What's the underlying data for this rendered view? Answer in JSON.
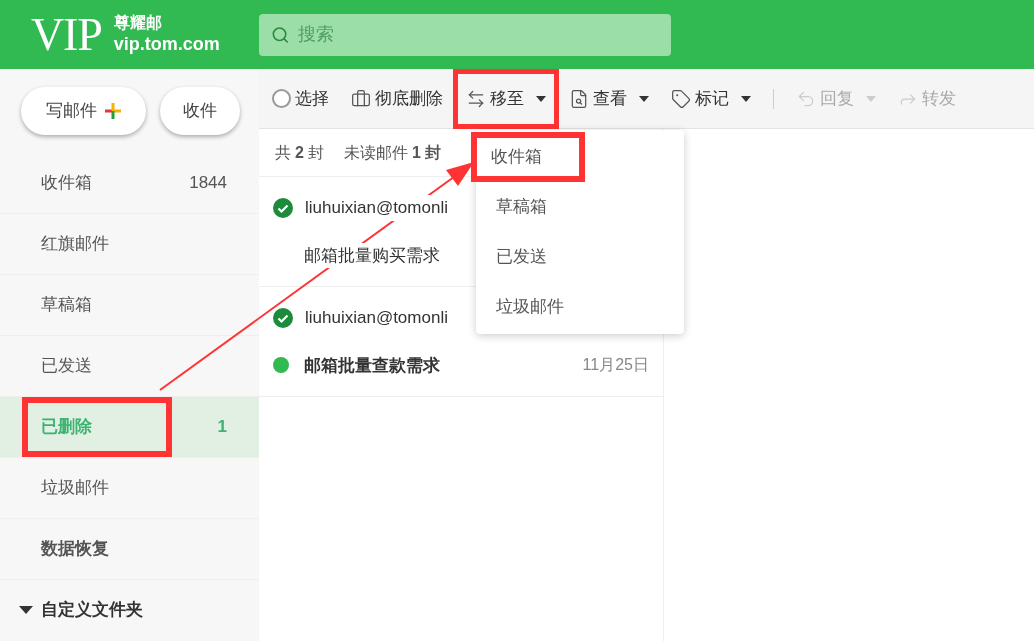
{
  "header": {
    "logo": "VIP",
    "brand": "尊耀邮",
    "domain": "vip.tom.com",
    "search": {
      "placeholder": "搜索"
    }
  },
  "compose_buttons": [
    {
      "kind": "compose",
      "label": "写邮件"
    },
    {
      "kind": "receive",
      "label": "收件"
    }
  ],
  "sidebar": {
    "items": [
      {
        "label": "收件箱",
        "count": "1844",
        "selected": false,
        "bold": false,
        "highlighted": false
      },
      {
        "label": "红旗邮件",
        "selected": false,
        "bold": false,
        "highlighted": false
      },
      {
        "label": "草稿箱",
        "selected": false,
        "bold": false,
        "highlighted": false
      },
      {
        "label": "已发送",
        "selected": false,
        "bold": false,
        "highlighted": false
      },
      {
        "label": "已删除",
        "count": "1",
        "selected": true,
        "bold": true,
        "highlighted": true
      },
      {
        "label": "垃圾邮件",
        "selected": false,
        "bold": false,
        "highlighted": false
      },
      {
        "label": "数据恢复",
        "selected": false,
        "bold": true,
        "highlighted": false
      }
    ],
    "folder_section": {
      "label": "自定义文件夹",
      "expanded": true
    }
  },
  "toolbar": [
    {
      "kind": "select",
      "label": "选择",
      "dropdown": false,
      "disabled": false,
      "highlighted": false
    },
    {
      "kind": "delete",
      "label": "彻底删除",
      "dropdown": false,
      "disabled": false,
      "highlighted": false
    },
    {
      "kind": "move",
      "label": "移至",
      "dropdown": true,
      "disabled": false,
      "highlighted": true
    },
    {
      "kind": "view",
      "label": "查看",
      "dropdown": true,
      "disabled": false,
      "highlighted": false
    },
    {
      "kind": "tag",
      "label": "标记",
      "dropdown": true,
      "disabled": false,
      "highlighted": false
    },
    {
      "kind": "divider"
    },
    {
      "kind": "reply",
      "label": "回复",
      "dropdown": true,
      "disabled": true,
      "highlighted": false
    },
    {
      "kind": "forward",
      "label": "转发",
      "dropdown": false,
      "disabled": true,
      "highlighted": false
    }
  ],
  "summary": {
    "total_prefix": "共",
    "total": "2",
    "total_suffix": "封",
    "unread_prefix": "未读邮件",
    "unread": "1",
    "unread_suffix": "封"
  },
  "messages": [
    {
      "sender": "liuhuixian@tomonli",
      "subject": "邮箱批量购买需求",
      "unread": false,
      "read_mark": true
    },
    {
      "sender": "liuhuixian@tomonli",
      "subject": "邮箱批量查款需求",
      "date": "11月25日",
      "unread": true,
      "read_mark": true
    }
  ],
  "move_menu": {
    "items": [
      {
        "label": "收件箱",
        "highlighted": true
      },
      {
        "label": "草稿箱",
        "highlighted": false
      },
      {
        "label": "已发送",
        "highlighted": false
      },
      {
        "label": "垃圾邮件",
        "highlighted": false
      }
    ]
  },
  "annotation_arrow": true
}
